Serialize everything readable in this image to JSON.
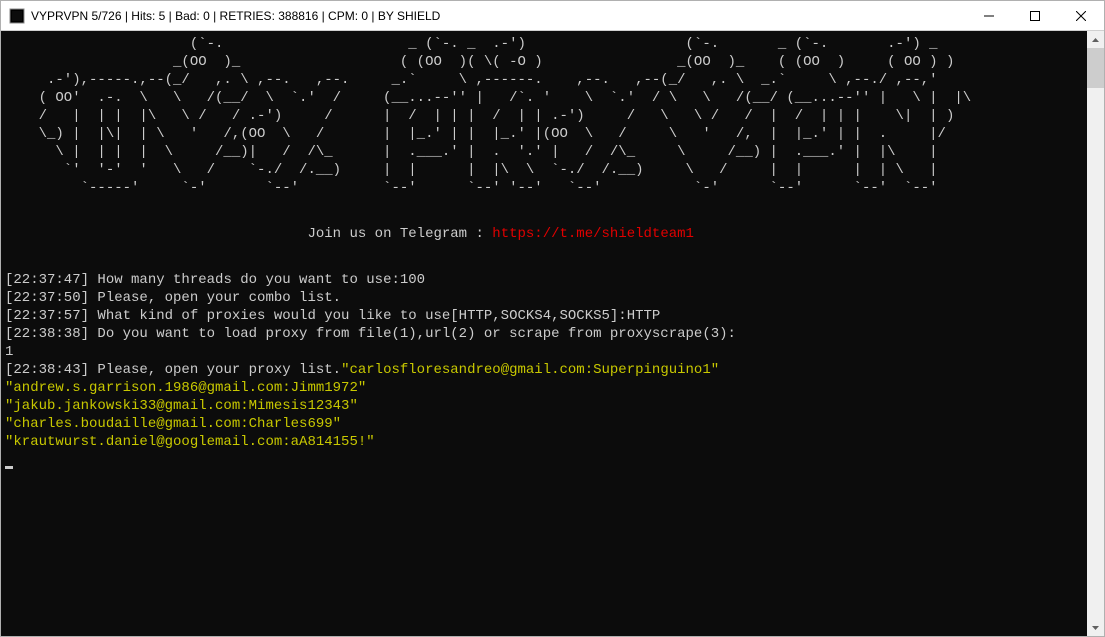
{
  "titlebar": {
    "text": "VYPRVPN 5/726 | Hits: 5 | Bad: 0 | RETRIES: 388816 | CPM: 0 | BY SHIELD"
  },
  "ascii_art": "                      (`-.                      _ (`-. _  .-')                   (`-.       _ (`-.       .-') _\n                    _(OO  )_                   ( (OO  )( \\( -O )                _(OO  )_    ( (OO  )     ( OO ) )\n     .-'),-----.,--(_/   ,. \\ ,--.   ,--.     _.`     \\ ,------.    ,--.   ,--(_/   ,. \\  _.`     \\ ,--./ ,--,'\n    ( OO'  .-.  \\   \\   /(__/  \\  `.'  /     (__...--'' |   /`. '    \\  `.'  / \\   \\   /(__/ (__...--'' |   \\ |  |\\\n    /   |  | |  |\\   \\ /   / .-')     /      |  /  | | |  /  | | .-')     /   \\   \\ /   /  |  /  | | |    \\|  | )\n    \\_) |  |\\|  | \\   '   /,(OO  \\   /       |  |_.' | |  |_.' |(OO  \\   /     \\   '   /,  |  |_.' | |  .     |/\n      \\ |  | |  |  \\     /__)|   /  /\\_      |  .___.' |  .  '.' |   /  /\\_     \\     /__) |  .___.' |  |\\    |\n       `'  '-'  '   \\   /    `-./  /.__)     |  |      |  |\\  \\  `-./  /.__)     \\   /     |  |      |  | \\   |\n         `-----'     `-'       `--'          `--'      `--' '--'   `--'           `-'      `--'      `--'  `--'",
  "telegram": {
    "prefix": "                                    ",
    "label": "Join us on Telegram : ",
    "link": "https://t.me/shieldteam1"
  },
  "log": [
    {
      "ts": "[22:37:47]",
      "text": " How many threads do you want to use:100"
    },
    {
      "ts": "[22:37:50]",
      "text": " Please, open your combo list."
    },
    {
      "ts": "[22:37:57]",
      "text": " What kind of proxies would you like to use[HTTP,SOCKS4,SOCKS5]:HTTP"
    },
    {
      "ts": "[22:38:38]",
      "text": " Do you want to load proxy from file(1),url(2) or scrape from proxyscrape(3):"
    }
  ],
  "user_input": "1",
  "log2_prefix": {
    "ts": "[22:38:43]",
    "text": " Please, open your proxy list."
  },
  "hits": [
    "\"carlosfloresandreo@gmail.com:Superpinguino1\"",
    "\"andrew.s.garrison.1986@gmail.com:Jimm1972\"",
    "\"jakub.jankowski33@gmail.com:Mimesis12343\"",
    "\"charles.boudaille@gmail.com:Charles699\"",
    "\"krautwurst.daniel@googlemail.com:aA814155!\""
  ]
}
